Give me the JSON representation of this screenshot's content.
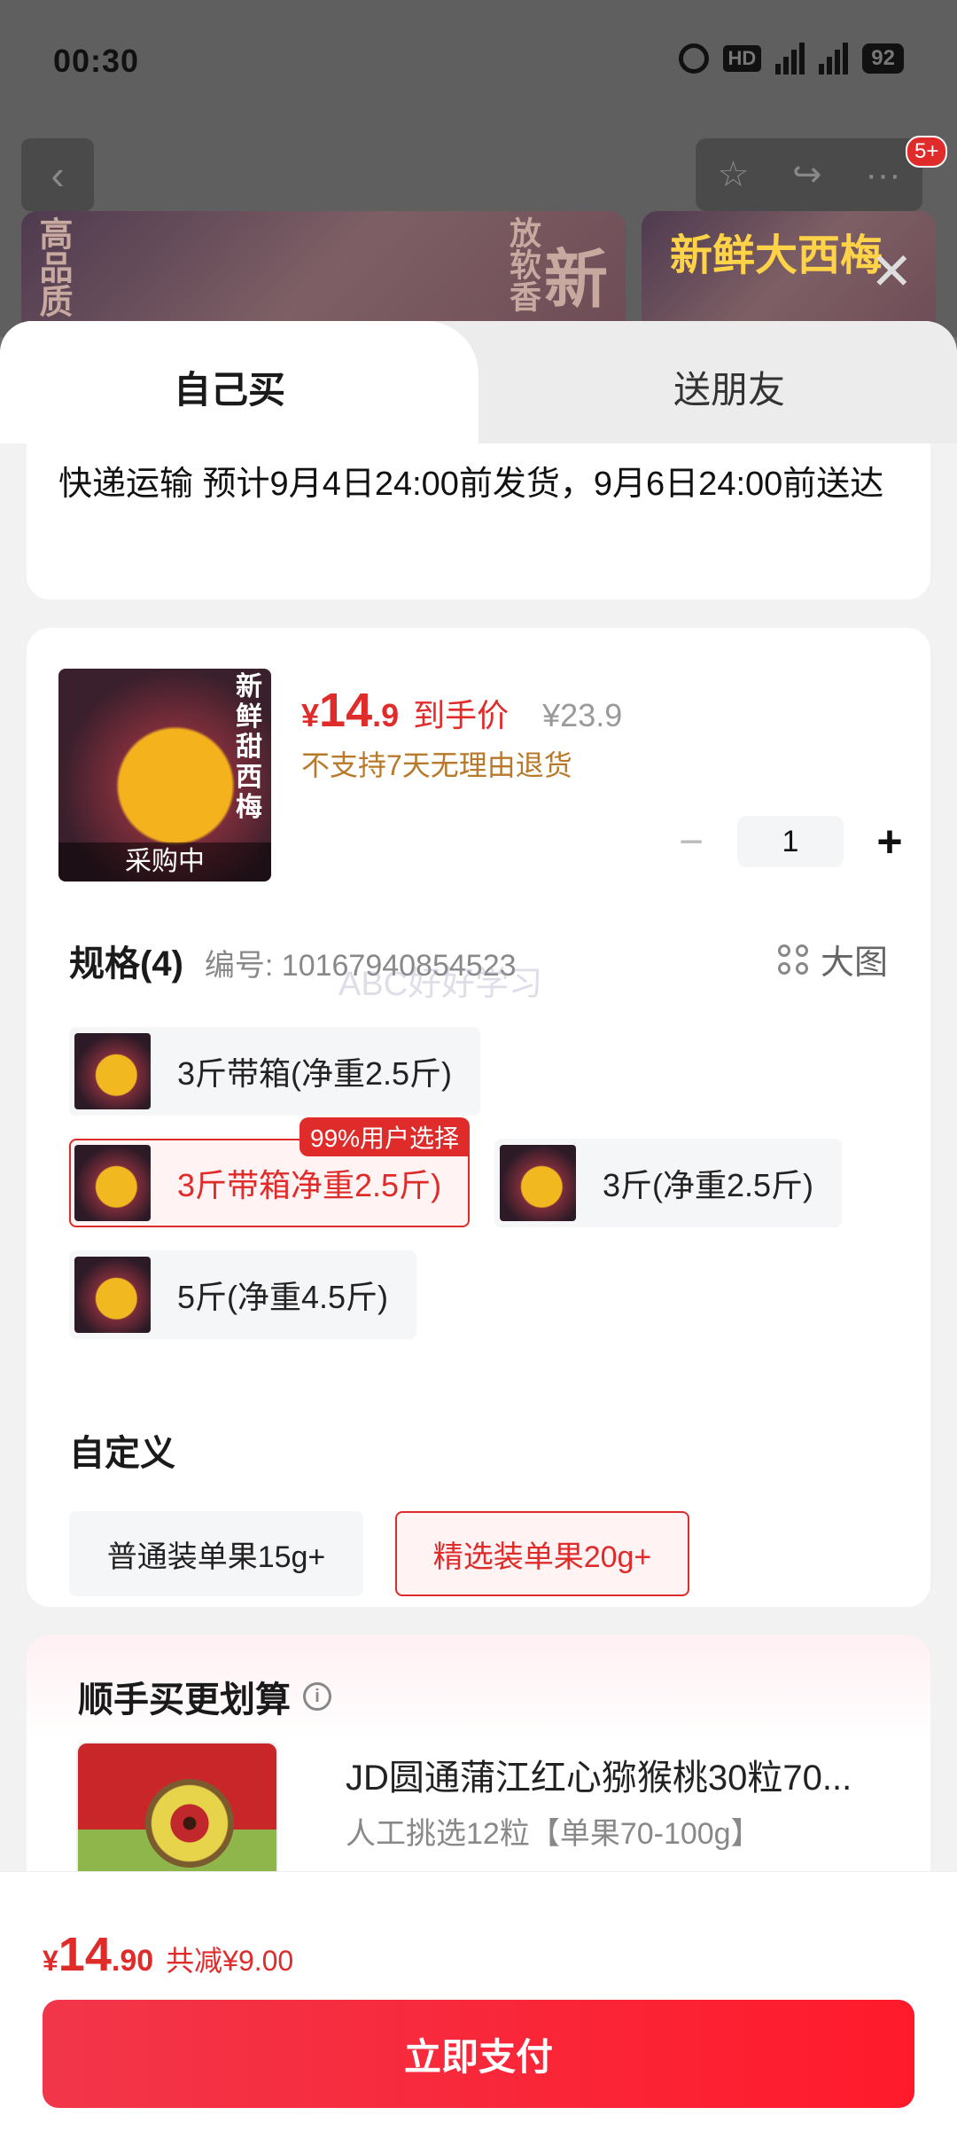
{
  "status_bar": {
    "time": "00:30",
    "hd": "HD",
    "battery": "92"
  },
  "background": {
    "badge": "5+",
    "banner_text_1": "新鲜",
    "banner_text_2": "放软香",
    "banner_text_3": "高品质",
    "banner_text_4": "新鲜大西梅"
  },
  "tabs": {
    "self": "自己买",
    "gift": "送朋友"
  },
  "delivery": {
    "text": "快递运输 预计9月4日24:00前发货，9月6日24:00前送达"
  },
  "product": {
    "image_label": "采购中",
    "image_title": "新鲜甜西梅",
    "price_yen": "¥",
    "price_int": "14",
    "price_dec": ".9",
    "price_label": "到手价",
    "original_price": "¥23.9",
    "return_policy": "不支持7天无理由退货",
    "quantity": "1"
  },
  "spec": {
    "title": "规格(4)",
    "code": "编号: 10167940854523",
    "big_image": "大图",
    "watermark": "ABC好好学习",
    "options": [
      {
        "label": "3斤带箱(净重2.5斤)"
      },
      {
        "label": "3斤带箱净重2.5斤)",
        "tag": "99%用户选择"
      },
      {
        "label": "3斤(净重2.5斤)"
      },
      {
        "label": "5斤(净重4.5斤)"
      }
    ]
  },
  "custom": {
    "title": "自定义",
    "options": [
      {
        "label": "普通装单果15g+"
      },
      {
        "label": "精选装单果20g+"
      }
    ]
  },
  "addon": {
    "title": "顺手买更划算",
    "name": "JD圆通蒲江红心猕猴桃30粒70...",
    "sub": "人工挑选12粒【单果70-100g】"
  },
  "footer": {
    "yen": "¥",
    "total_int": "14",
    "total_dec": ".90",
    "saving": "共减¥9.00",
    "pay_label": "立即支付"
  },
  "colors": {
    "accent": "#e02b2b",
    "warning_text": "#b8792a"
  }
}
